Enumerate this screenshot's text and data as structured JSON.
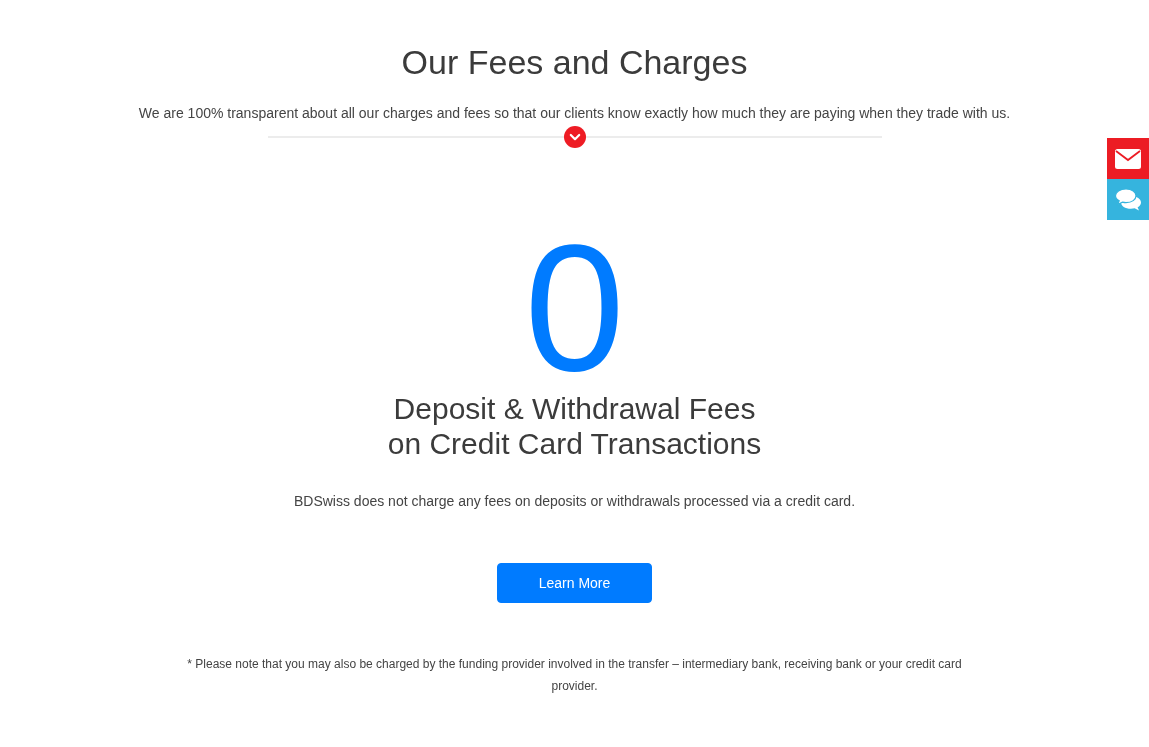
{
  "title": "Our Fees and Charges",
  "intro": "We are 100% transparent about all our charges and fees so that our clients know exactly how much they are paying when they trade with us.",
  "big_figure": "0",
  "heading_lines": [
    "Deposit & Withdrawal Fees",
    "on Credit Card Transactions"
  ],
  "description": "BDSwiss does not charge any fees on deposits or withdrawals processed via a credit card.",
  "button": {
    "label": "Learn More"
  },
  "footnote": "* Please note that you may also be charged by the funding provider involved in the transfer – intermediary bank, receiving bank or your credit card provider.",
  "side_buttons": [
    {
      "kind": "mail"
    },
    {
      "kind": "chat"
    }
  ]
}
